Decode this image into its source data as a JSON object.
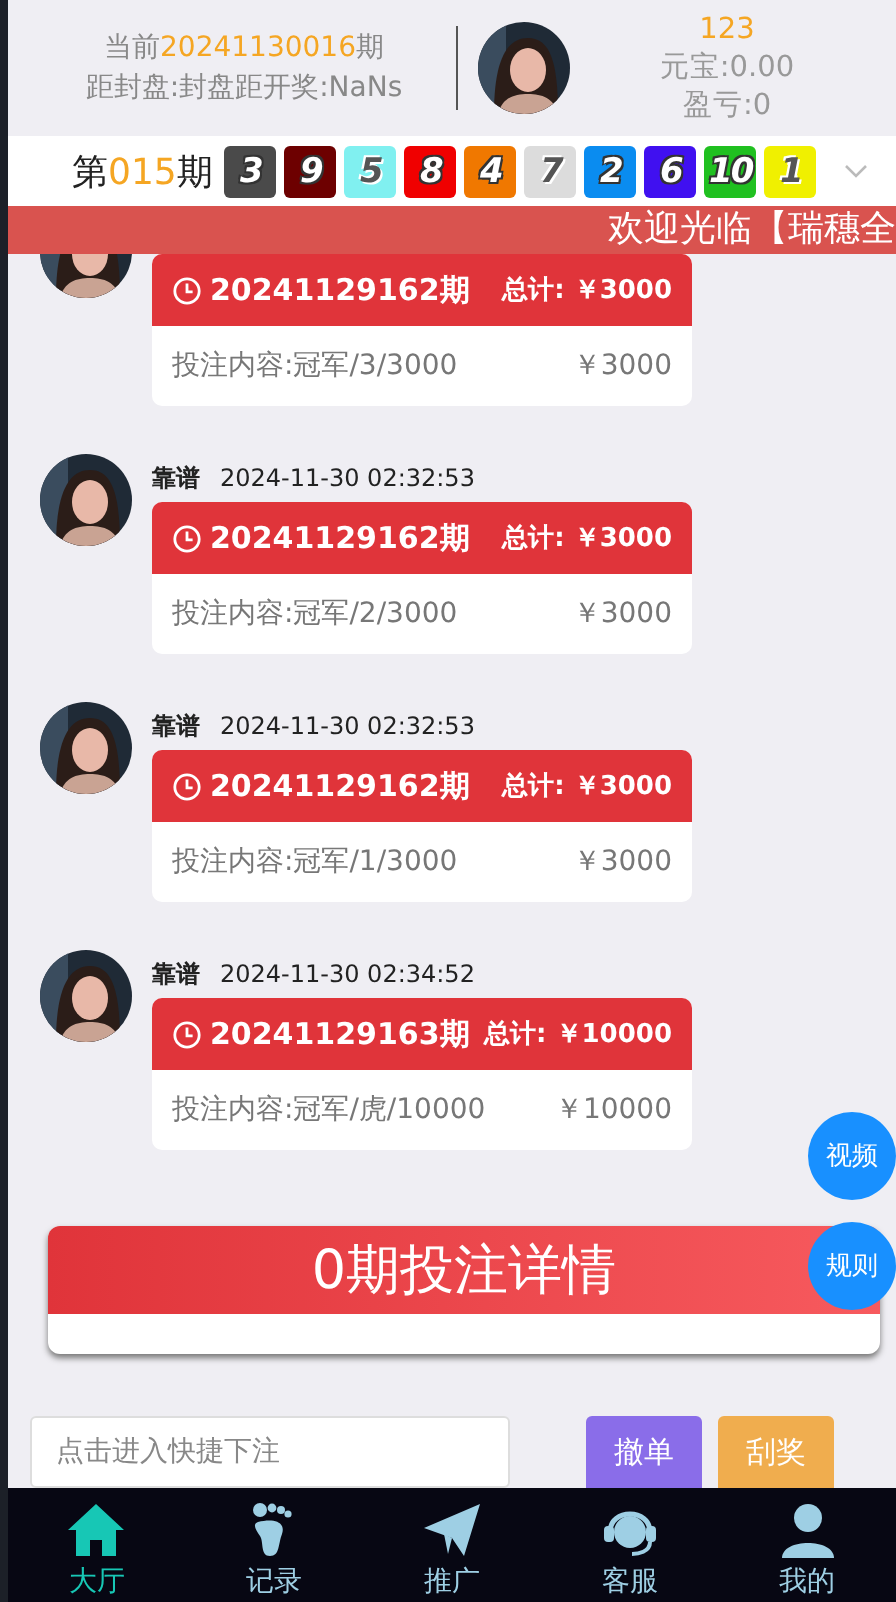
{
  "header": {
    "period_prefix": "当前",
    "period": "20241130016",
    "period_suffix": "期",
    "countdown": "距封盘:封盘距开奖:NaNs",
    "username": "123",
    "balance": "元宝:0.00",
    "profit": "盈亏:0"
  },
  "results": {
    "prefix": "第",
    "period": "015",
    "suffix": "期",
    "balls": [
      {
        "number": "3",
        "color": "#4a4a4a"
      },
      {
        "number": "9",
        "color": "#6d0000"
      },
      {
        "number": "5",
        "color": "#80f0f0"
      },
      {
        "number": "8",
        "color": "#f00000"
      },
      {
        "number": "4",
        "color": "#f07800"
      },
      {
        "number": "7",
        "color": "#dcdcdc"
      },
      {
        "number": "2",
        "color": "#0a8cf0"
      },
      {
        "number": "6",
        "color": "#4010f0"
      },
      {
        "number": "10",
        "color": "#20c020"
      },
      {
        "number": "1",
        "color": "#f0f000"
      }
    ]
  },
  "marquee": "欢迎光临【瑞穗全",
  "messages": [
    {
      "period": "20241129162期",
      "total_label": "总计:",
      "total": "￥3000",
      "content": "投注内容:冠军/3/3000",
      "amount": "￥3000"
    },
    {
      "name": "靠谱",
      "time": "2024-11-30 02:32:53",
      "period": "20241129162期",
      "total_label": "总计:",
      "total": "￥3000",
      "content": "投注内容:冠军/2/3000",
      "amount": "￥3000"
    },
    {
      "name": "靠谱",
      "time": "2024-11-30 02:32:53",
      "period": "20241129162期",
      "total_label": "总计:",
      "total": "￥3000",
      "content": "投注内容:冠军/1/3000",
      "amount": "￥3000"
    },
    {
      "name": "靠谱",
      "time": "2024-11-30 02:34:52",
      "period": "20241129163期",
      "total_label": "总计:",
      "total": "￥10000",
      "content": "投注内容:冠军/虎/10000",
      "amount": "￥10000"
    }
  ],
  "bet_detail": "0期投注详情",
  "floating_buttons": [
    "视频",
    "规则"
  ],
  "quick_bet": {
    "placeholder": "点击进入快捷下注",
    "buttons": [
      "撤单",
      "刮奖"
    ]
  },
  "nav": [
    {
      "label": "大厅",
      "kind": "home",
      "selected": true
    },
    {
      "label": "记录",
      "kind": "foot",
      "selected": false
    },
    {
      "label": "推广",
      "kind": "plane",
      "selected": false
    },
    {
      "label": "客服",
      "kind": "headset",
      "selected": false
    },
    {
      "label": "我的",
      "kind": "user",
      "selected": false
    }
  ]
}
